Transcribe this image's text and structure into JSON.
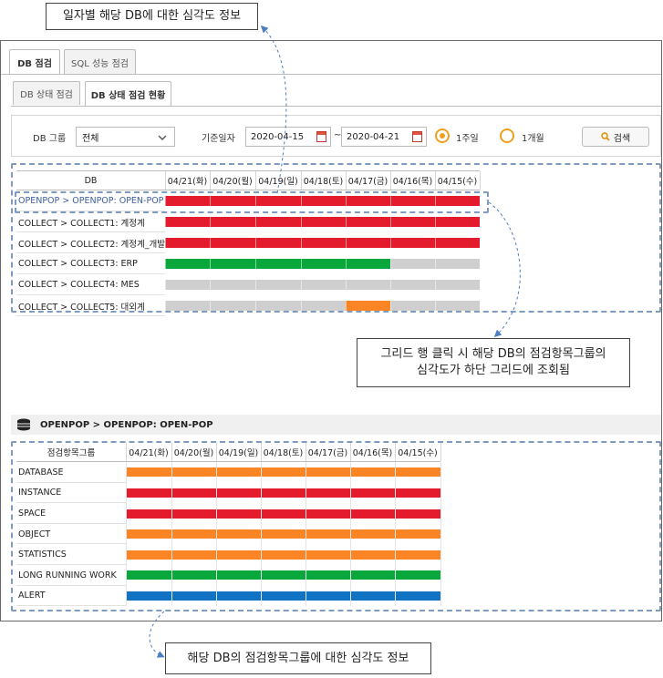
{
  "callouts": {
    "top": "일자별 해당 DB에 대한 심각도 정보",
    "middle_line1": "그리드 행 클릭 시 해당 DB의 점검항목그룹의",
    "middle_line2": "심각도가 하단 그리드에 조회됨",
    "bottom": "해당 DB의 점검항목그룹에 대한 심각도 정보"
  },
  "tabs": [
    {
      "label": "DB 점검",
      "active": true
    },
    {
      "label": "SQL 성능 점검",
      "active": false
    }
  ],
  "subtabs": [
    {
      "label": "DB 상태 점검",
      "active": false
    },
    {
      "label": "DB 상태 점검 현황",
      "active": true
    }
  ],
  "filters": {
    "db_group_label": "DB 그룹",
    "db_group_value": "전체",
    "date_label": "기준일자",
    "date_from": "2020-04-15",
    "date_sep": "~",
    "date_to": "2020-04-21",
    "period_options": [
      {
        "label": "1주일",
        "selected": true
      },
      {
        "label": "1개월",
        "selected": false
      }
    ],
    "search_label": "검색"
  },
  "colors": {
    "red": "#e31b2d",
    "green": "#0aa83c",
    "gray": "#cfcfcf",
    "orange": "#fb8424",
    "blue": "#1272c4",
    "accent": "#f0a020"
  },
  "grid1": {
    "db_header": "DB",
    "dates": [
      "04/21(화)",
      "04/20(월)",
      "04/19(일)",
      "04/18(토)",
      "04/17(금)",
      "04/16(목)",
      "04/15(수)"
    ],
    "rows": [
      {
        "name": "OPENPOP > OPENPOP: OPEN-POP",
        "cells": [
          "red",
          "red",
          "red",
          "red",
          "red",
          "red",
          "red"
        ]
      },
      {
        "name": "COLLECT > COLLECT1: 계정계",
        "cells": [
          "red",
          "red",
          "red",
          "red",
          "red",
          "red",
          "red"
        ]
      },
      {
        "name": "COLLECT > COLLECT2: 계정계_개발",
        "cells": [
          "red",
          "red",
          "red",
          "red",
          "red",
          "red",
          "red"
        ]
      },
      {
        "name": "COLLECT > COLLECT3: ERP",
        "cells": [
          "green",
          "green",
          "green",
          "green",
          "green",
          "gray",
          "gray"
        ]
      },
      {
        "name": "COLLECT > COLLECT4: MES",
        "cells": [
          "gray",
          "gray",
          "gray",
          "gray",
          "gray",
          "gray",
          "gray"
        ]
      },
      {
        "name": "COLLECT > COLLECT5: 대외계",
        "cells": [
          "gray",
          "gray",
          "gray",
          "gray",
          "orange",
          "gray",
          "gray"
        ]
      }
    ]
  },
  "detail": {
    "title": "OPENPOP > OPENPOP: OPEN-POP",
    "icon": "database-icon"
  },
  "grid2": {
    "group_header": "점검항목그룹",
    "dates": [
      "04/21(화)",
      "04/20(월)",
      "04/19(일)",
      "04/18(토)",
      "04/17(금)",
      "04/16(목)",
      "04/15(수)"
    ],
    "rows": [
      {
        "name": "DATABASE",
        "color": "orange"
      },
      {
        "name": "INSTANCE",
        "color": "red"
      },
      {
        "name": "SPACE",
        "color": "red"
      },
      {
        "name": "OBJECT",
        "color": "orange"
      },
      {
        "name": "STATISTICS",
        "color": "orange"
      },
      {
        "name": "LONG RUNNING WORK",
        "color": "green"
      },
      {
        "name": "ALERT",
        "color": "blue"
      }
    ]
  }
}
